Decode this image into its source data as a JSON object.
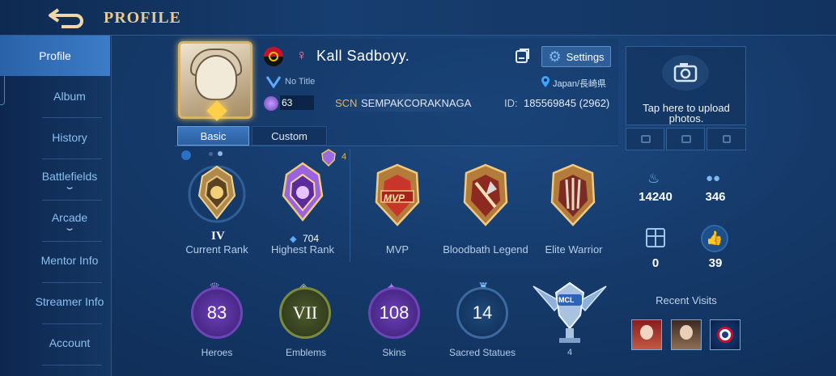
{
  "header": {
    "title": "PROFILE"
  },
  "sidebar": {
    "items": [
      {
        "label": "Profile"
      },
      {
        "label": "Album"
      },
      {
        "label": "History"
      },
      {
        "label": "Battlefields"
      },
      {
        "label": "Arcade"
      },
      {
        "label": "Mentor Info"
      },
      {
        "label": "Streamer Info"
      },
      {
        "label": "Account"
      }
    ]
  },
  "profile": {
    "name": "Kall Sadboyy.",
    "title_text": "No Title",
    "location": "Japan/長崎県",
    "level": "63",
    "squad_tag": "SCN",
    "squad_name": "SEMPAKCORAKNAGA",
    "id_label": "ID:",
    "id_value": "185569845 (2962)",
    "settings_label": "Settings"
  },
  "tabs": [
    {
      "label": "Basic"
    },
    {
      "label": "Custom"
    }
  ],
  "achievements": {
    "current_rank_label": "Current Rank",
    "current_rank_roman": "IV",
    "highest_rank_label": "Highest Rank",
    "highest_rank_points": "704",
    "badge_count": "4",
    "mvp_label": "MVP",
    "mvp_badge_text": "MVP",
    "bloodbath_label": "Bloodbath Legend",
    "elite_label": "Elite Warrior"
  },
  "collection": {
    "heroes": {
      "value": "83",
      "label": "Heroes"
    },
    "emblems": {
      "value": "VII",
      "label": "Emblems"
    },
    "skins": {
      "value": "108",
      "label": "Skins"
    },
    "statues": {
      "value": "14",
      "label": "Sacred Statues"
    },
    "mcl": {
      "value": "4",
      "badge_text": "MCL"
    }
  },
  "right_panel": {
    "upload_text": "Tap here to upload photos.",
    "popularity": "14240",
    "followers": "346",
    "gifts": "0",
    "likes": "39",
    "recent_visits_label": "Recent Visits"
  },
  "colors": {
    "gold": "#e9c98d",
    "accent": "#3d7cc8",
    "purple": "#8f5fd6"
  }
}
